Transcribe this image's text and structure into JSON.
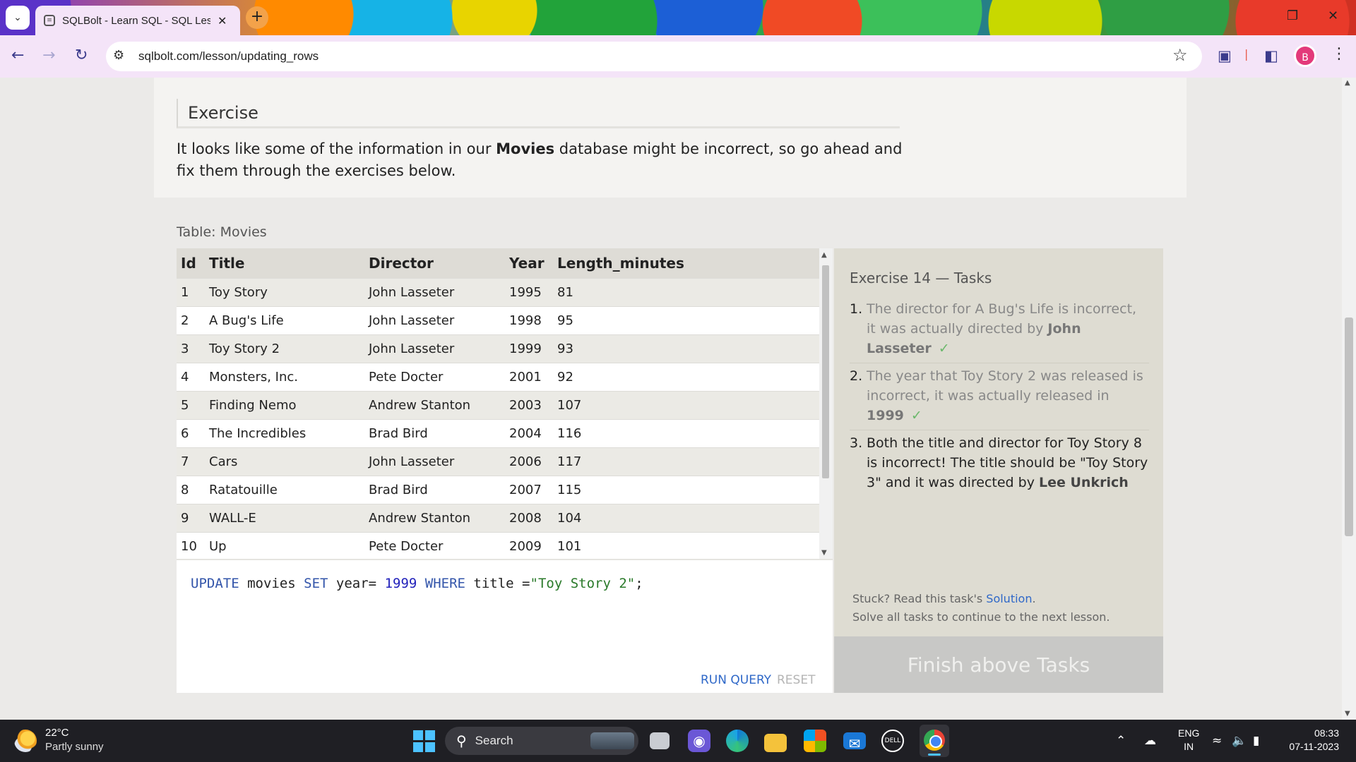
{
  "browser": {
    "tab_title": "SQLBolt - Learn SQL - SQL Less",
    "url": "sqlbolt.com/lesson/updating_rows",
    "profile_initial": "B"
  },
  "exercise": {
    "heading": "Exercise",
    "intro_part1": "It looks like some of the information in our ",
    "intro_bold": "Movies",
    "intro_part2": " database might be incorrect, so go ahead and fix them through the exercises below."
  },
  "table": {
    "caption": "Table: Movies",
    "columns": [
      "Id",
      "Title",
      "Director",
      "Year",
      "Length_minutes"
    ],
    "rows": [
      [
        "1",
        "Toy Story",
        "John Lasseter",
        "1995",
        "81"
      ],
      [
        "2",
        "A Bug's Life",
        "John Lasseter",
        "1998",
        "95"
      ],
      [
        "3",
        "Toy Story 2",
        "John Lasseter",
        "1999",
        "93"
      ],
      [
        "4",
        "Monsters, Inc.",
        "Pete Docter",
        "2001",
        "92"
      ],
      [
        "5",
        "Finding Nemo",
        "Andrew Stanton",
        "2003",
        "107"
      ],
      [
        "6",
        "The Incredibles",
        "Brad Bird",
        "2004",
        "116"
      ],
      [
        "7",
        "Cars",
        "John Lasseter",
        "2006",
        "117"
      ],
      [
        "8",
        "Ratatouille",
        "Brad Bird",
        "2007",
        "115"
      ],
      [
        "9",
        "WALL-E",
        "Andrew Stanton",
        "2008",
        "104"
      ],
      [
        "10",
        "Up",
        "Pete Docter",
        "2009",
        "101"
      ]
    ]
  },
  "editor": {
    "tokens": [
      {
        "t": "UPDATE",
        "c": "kw"
      },
      {
        "t": " movies ",
        "c": "plain"
      },
      {
        "t": "SET",
        "c": "kw"
      },
      {
        "t": " year= ",
        "c": "plain"
      },
      {
        "t": "1999",
        "c": "num"
      },
      {
        "t": " ",
        "c": "plain"
      },
      {
        "t": "WHERE",
        "c": "kw"
      },
      {
        "t": " title =",
        "c": "plain"
      },
      {
        "t": "\"Toy Story 2\"",
        "c": "str"
      },
      {
        "t": ";",
        "c": "plain"
      }
    ],
    "run_label": "RUN QUERY",
    "reset_label": "RESET"
  },
  "tasks": {
    "title": "Exercise 14 — Tasks",
    "items": [
      {
        "num": "1.",
        "text": "The director for A Bug's Life is incorrect, it was actually directed by ",
        "bold": "John Lasseter",
        "done": true
      },
      {
        "num": "2.",
        "text": "The year that Toy Story 2 was released is incorrect, it was actually released in ",
        "bold": "1999",
        "done": true
      },
      {
        "num": "3.",
        "text": "Both the title and director for Toy Story 8 is incorrect! The title should be \"Toy Story 3\" and it was directed by ",
        "bold": "Lee Unkrich",
        "done": false
      }
    ],
    "checkmark": "✓",
    "stuck_prefix": "Stuck? Read this task's ",
    "solution_link": "Solution",
    "stuck_suffix": ".",
    "solve_all": "Solve all tasks to continue to the next lesson.",
    "finish_label": "Finish above Tasks"
  },
  "taskbar": {
    "temperature": "22°C",
    "weather": "Partly sunny",
    "search_label": "Search",
    "lang_line1": "ENG",
    "lang_line2": "IN",
    "time": "08:33",
    "date": "07-11-2023"
  }
}
